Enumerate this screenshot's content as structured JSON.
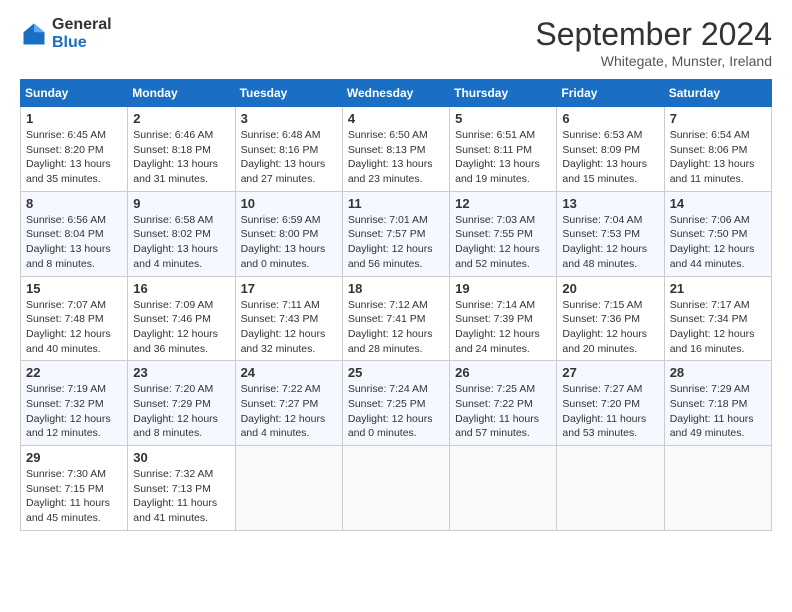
{
  "header": {
    "logo_general": "General",
    "logo_blue": "Blue",
    "month_title": "September 2024",
    "location": "Whitegate, Munster, Ireland"
  },
  "days_of_week": [
    "Sunday",
    "Monday",
    "Tuesday",
    "Wednesday",
    "Thursday",
    "Friday",
    "Saturday"
  ],
  "weeks": [
    [
      {
        "day": "1",
        "info": "Sunrise: 6:45 AM\nSunset: 8:20 PM\nDaylight: 13 hours\nand 35 minutes."
      },
      {
        "day": "2",
        "info": "Sunrise: 6:46 AM\nSunset: 8:18 PM\nDaylight: 13 hours\nand 31 minutes."
      },
      {
        "day": "3",
        "info": "Sunrise: 6:48 AM\nSunset: 8:16 PM\nDaylight: 13 hours\nand 27 minutes."
      },
      {
        "day": "4",
        "info": "Sunrise: 6:50 AM\nSunset: 8:13 PM\nDaylight: 13 hours\nand 23 minutes."
      },
      {
        "day": "5",
        "info": "Sunrise: 6:51 AM\nSunset: 8:11 PM\nDaylight: 13 hours\nand 19 minutes."
      },
      {
        "day": "6",
        "info": "Sunrise: 6:53 AM\nSunset: 8:09 PM\nDaylight: 13 hours\nand 15 minutes."
      },
      {
        "day": "7",
        "info": "Sunrise: 6:54 AM\nSunset: 8:06 PM\nDaylight: 13 hours\nand 11 minutes."
      }
    ],
    [
      {
        "day": "8",
        "info": "Sunrise: 6:56 AM\nSunset: 8:04 PM\nDaylight: 13 hours\nand 8 minutes."
      },
      {
        "day": "9",
        "info": "Sunrise: 6:58 AM\nSunset: 8:02 PM\nDaylight: 13 hours\nand 4 minutes."
      },
      {
        "day": "10",
        "info": "Sunrise: 6:59 AM\nSunset: 8:00 PM\nDaylight: 13 hours\nand 0 minutes."
      },
      {
        "day": "11",
        "info": "Sunrise: 7:01 AM\nSunset: 7:57 PM\nDaylight: 12 hours\nand 56 minutes."
      },
      {
        "day": "12",
        "info": "Sunrise: 7:03 AM\nSunset: 7:55 PM\nDaylight: 12 hours\nand 52 minutes."
      },
      {
        "day": "13",
        "info": "Sunrise: 7:04 AM\nSunset: 7:53 PM\nDaylight: 12 hours\nand 48 minutes."
      },
      {
        "day": "14",
        "info": "Sunrise: 7:06 AM\nSunset: 7:50 PM\nDaylight: 12 hours\nand 44 minutes."
      }
    ],
    [
      {
        "day": "15",
        "info": "Sunrise: 7:07 AM\nSunset: 7:48 PM\nDaylight: 12 hours\nand 40 minutes."
      },
      {
        "day": "16",
        "info": "Sunrise: 7:09 AM\nSunset: 7:46 PM\nDaylight: 12 hours\nand 36 minutes."
      },
      {
        "day": "17",
        "info": "Sunrise: 7:11 AM\nSunset: 7:43 PM\nDaylight: 12 hours\nand 32 minutes."
      },
      {
        "day": "18",
        "info": "Sunrise: 7:12 AM\nSunset: 7:41 PM\nDaylight: 12 hours\nand 28 minutes."
      },
      {
        "day": "19",
        "info": "Sunrise: 7:14 AM\nSunset: 7:39 PM\nDaylight: 12 hours\nand 24 minutes."
      },
      {
        "day": "20",
        "info": "Sunrise: 7:15 AM\nSunset: 7:36 PM\nDaylight: 12 hours\nand 20 minutes."
      },
      {
        "day": "21",
        "info": "Sunrise: 7:17 AM\nSunset: 7:34 PM\nDaylight: 12 hours\nand 16 minutes."
      }
    ],
    [
      {
        "day": "22",
        "info": "Sunrise: 7:19 AM\nSunset: 7:32 PM\nDaylight: 12 hours\nand 12 minutes."
      },
      {
        "day": "23",
        "info": "Sunrise: 7:20 AM\nSunset: 7:29 PM\nDaylight: 12 hours\nand 8 minutes."
      },
      {
        "day": "24",
        "info": "Sunrise: 7:22 AM\nSunset: 7:27 PM\nDaylight: 12 hours\nand 4 minutes."
      },
      {
        "day": "25",
        "info": "Sunrise: 7:24 AM\nSunset: 7:25 PM\nDaylight: 12 hours\nand 0 minutes."
      },
      {
        "day": "26",
        "info": "Sunrise: 7:25 AM\nSunset: 7:22 PM\nDaylight: 11 hours\nand 57 minutes."
      },
      {
        "day": "27",
        "info": "Sunrise: 7:27 AM\nSunset: 7:20 PM\nDaylight: 11 hours\nand 53 minutes."
      },
      {
        "day": "28",
        "info": "Sunrise: 7:29 AM\nSunset: 7:18 PM\nDaylight: 11 hours\nand 49 minutes."
      }
    ],
    [
      {
        "day": "29",
        "info": "Sunrise: 7:30 AM\nSunset: 7:15 PM\nDaylight: 11 hours\nand 45 minutes."
      },
      {
        "day": "30",
        "info": "Sunrise: 7:32 AM\nSunset: 7:13 PM\nDaylight: 11 hours\nand 41 minutes."
      },
      null,
      null,
      null,
      null,
      null
    ]
  ]
}
